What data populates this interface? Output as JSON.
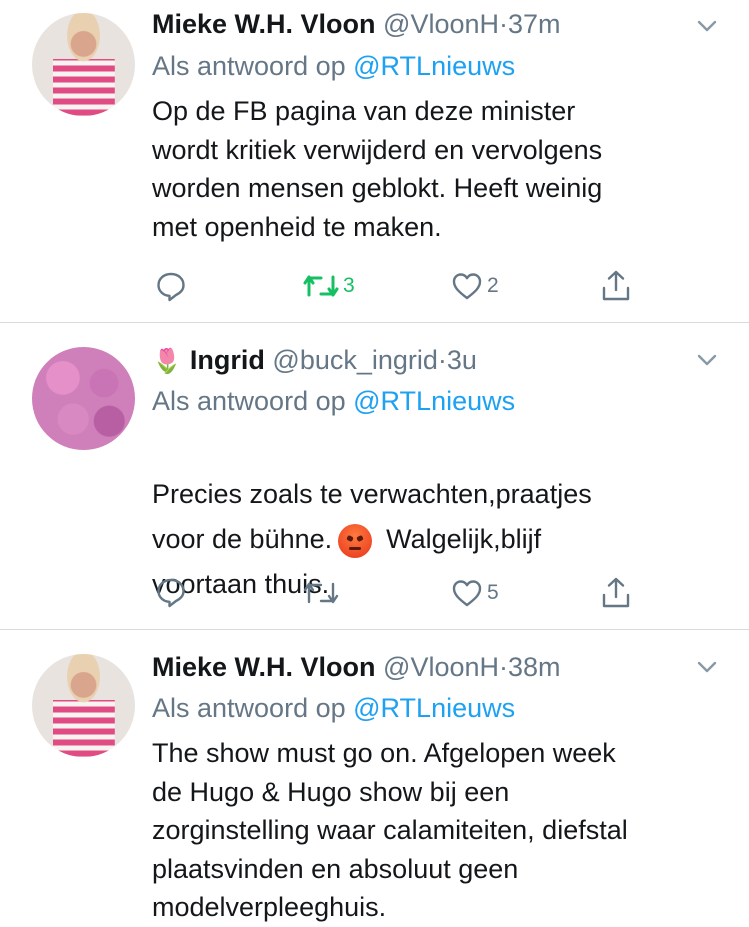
{
  "tweets": [
    {
      "name": "Mieke W.H. Vloon",
      "handle": "@VloonH",
      "separator": "·",
      "time": "37m",
      "reply_prefix": "Als antwoord op",
      "reply_to": "@RTLnieuws",
      "text": "Op de FB pagina van deze minister\nwordt kritiek verwijderd en vervolgens\nworden mensen geblokt. Heeft weinig\nmet openheid te maken.",
      "retweets": "3",
      "likes": "2"
    },
    {
      "emoji": "🌷",
      "name": "Ingrid",
      "handle": "@buck_ingrid",
      "separator": "·",
      "time": "3u",
      "reply_prefix": "Als antwoord op",
      "reply_to": "@RTLnieuws",
      "text_part1": "Precies zoals te verwachten,praatjes\nvoor de bühne.",
      "text_part2": "Walgelijk,blijf\nvoortaan thuis.",
      "likes": "5"
    },
    {
      "name": "Mieke W.H. Vloon",
      "handle": "@VloonH",
      "separator": "·",
      "time": "38m",
      "reply_prefix": "Als antwoord op",
      "reply_to": "@RTLnieuws",
      "text": "The show must go on. Afgelopen week\nde Hugo & Hugo show bij een\nzorginstelling waar calamiteiten, diefstal\nplaatsvinden en absoluut geen\nmodelverpleeghuis."
    }
  ],
  "colors": {
    "text": "#14171a",
    "secondary": "#657786",
    "link": "#1da1f2",
    "retweet_active": "#17bf63",
    "divider": "#d6dbdf"
  },
  "icons": [
    "reply-icon",
    "retweet-icon",
    "like-icon",
    "share-icon",
    "chevron-down-icon"
  ]
}
